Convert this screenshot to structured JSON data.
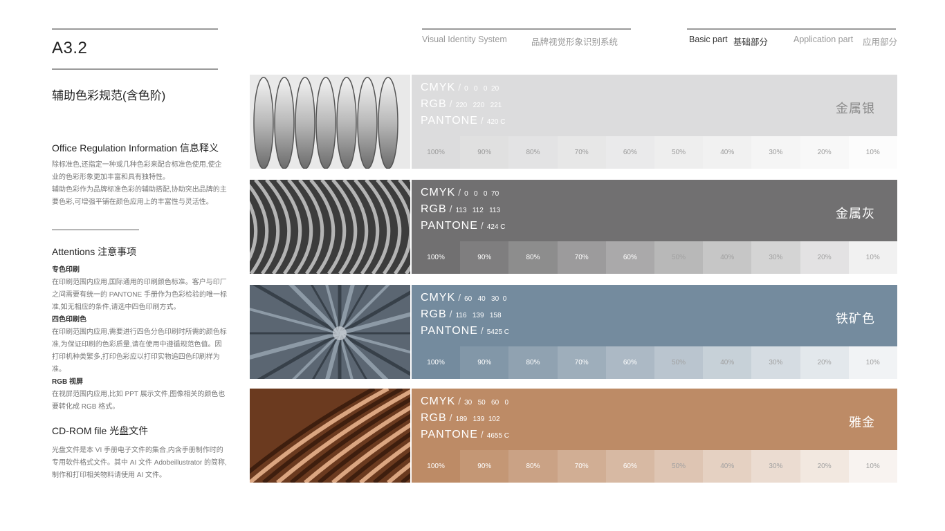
{
  "header": {
    "page_code": "A3.2",
    "nav": {
      "vis_en": "Visual Identity System",
      "vis_cn": "品牌视觉形象识别系统",
      "basic_en": "Basic part",
      "basic_cn": "基础部分",
      "app_en": "Application part",
      "app_cn": "应用部分"
    }
  },
  "left": {
    "section_title": "辅助色彩规范(含色阶)",
    "office": {
      "heading": "Office Regulation Information 信息释义",
      "p1": "除标准色,还指定一种或几种色彩来配合标准色使用,使企业的色彩形象更加丰富和具有独特性。",
      "p2": "辅助色彩作为品牌标准色彩的辅助搭配,协助突出品牌的主要色彩,可增强平铺在颜色应用上的丰富性与灵活性。"
    },
    "attentions": {
      "heading": "Attentions 注意事项",
      "s1_title": "专色印刷",
      "s1_text": "在印刷范围内应用,国际通用的印刷颜色标准。客户与印厂之间需要有统一的 PANTONE 手册作为色彩检验的唯一标准,如无相应的条件,请选中四色印刷方式。",
      "s2_title": "四色印刷色",
      "s2_text": "在印刷范围内应用,需要进行四色分色印刷时所需的颜色标准,为保证印刷的色彩质量,请在使用中遵循规范色值。因打印机种类繁多,打印色彩应以打印实物追四色印刷样为准。",
      "s3_title": "RGB 视屏",
      "s3_text": "在视屏范围内应用,比如 PPT 展示文件,图像相关的颜色也要转化成 RGB 格式。"
    },
    "cdrom": {
      "heading": "CD-ROM file 光盘文件",
      "text": "光盘文件是本 VI 手册电子文件的集合,内含手册制作时的专用软件格式文件。其中 AI 文件 Adobeillustrator 的简称,制作和打印相关物料请使用 AI 文件。"
    }
  },
  "labels": {
    "cmyk": "CMYK",
    "rgb": "RGB",
    "pantone": "PANTONE",
    "slash": "/"
  },
  "tint_labels": [
    "100%",
    "90%",
    "80%",
    "70%",
    "60%",
    "50%",
    "40%",
    "30%",
    "20%",
    "10%"
  ],
  "swatches": [
    {
      "name": "金属银",
      "photo_icon": "metal-silver-rings-photo",
      "cmyk": "0   0   0  20",
      "rgb": "220   220   221",
      "pantone": "420 C",
      "color": "#dcdcdd",
      "text_color": "#ffffff",
      "name_color": "#8a8a8a"
    },
    {
      "name": "金属灰",
      "photo_icon": "metal-grey-coil-photo",
      "cmyk": "0   0   0  70",
      "rgb": "113   112   113",
      "pantone": "424 C",
      "color": "#717071",
      "text_color": "#ffffff",
      "name_color": "#ffffff"
    },
    {
      "name": "铁矿色",
      "photo_icon": "iron-ore-photo",
      "cmyk": "60   40   30  0",
      "rgb": "116   139   158",
      "pantone": "5425 C",
      "color": "#748b9e",
      "text_color": "#ffffff",
      "name_color": "#ffffff"
    },
    {
      "name": "雅金",
      "photo_icon": "copper-gold-photo",
      "cmyk": "30   50   60   0",
      "rgb": "189   139  102",
      "pantone": "4655 C",
      "color": "#bd8b66",
      "text_color": "#ffffff",
      "name_color": "#ffffff"
    }
  ]
}
